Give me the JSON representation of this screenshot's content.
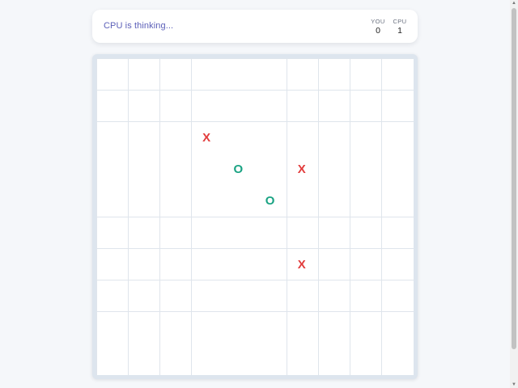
{
  "status": {
    "text": "CPU is thinking..."
  },
  "scoreboard": {
    "you": {
      "label": "YOU",
      "value": "0"
    },
    "cpu": {
      "label": "CPU",
      "value": "1"
    }
  },
  "board": {
    "size": 10,
    "marks": [
      {
        "symbol": "X",
        "row": 2,
        "col": 3
      },
      {
        "symbol": "O",
        "row": 3,
        "col": 4
      },
      {
        "symbol": "X",
        "row": 3,
        "col": 6
      },
      {
        "symbol": "O",
        "row": 4,
        "col": 5
      },
      {
        "symbol": "X",
        "row": 6,
        "col": 6
      }
    ]
  },
  "colors": {
    "x": "#e23d3d",
    "o": "#1aa383",
    "status": "#5b5fb8",
    "grid": "#dfe5ec"
  }
}
